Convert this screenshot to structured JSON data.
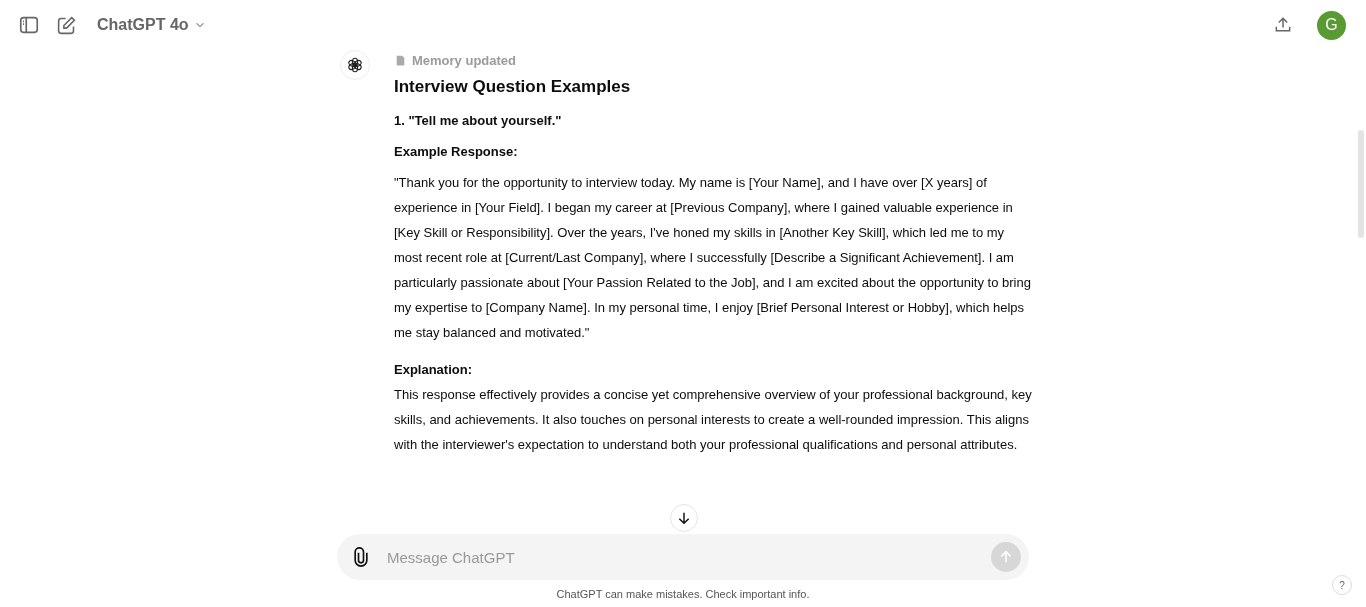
{
  "header": {
    "model": "ChatGPT 4o",
    "avatar": "G"
  },
  "message": {
    "status": "Memory updated",
    "title": "Interview Question Examples",
    "blocks": [
      {
        "kind": "bold",
        "text": "1. \"Tell me about yourself.\""
      },
      {
        "kind": "bold",
        "text": "Example Response:"
      },
      {
        "kind": "para",
        "text": "\"Thank you for the opportunity to interview today. My name is [Your Name], and I have over [X years] of experience in [Your Field]. I began my career at [Previous Company], where I gained valuable experience in [Key Skill or Responsibility]. Over the years, I've honed my skills in [Another Key Skill], which led me to my most recent role at [Current/Last Company], where I successfully [Describe a Significant Achievement]. I am particularly passionate about [Your Passion Related to the Job], and I am excited about the opportunity to bring my expertise to [Company Name]. In my personal time, I enjoy [Brief Personal Interest or Hobby], which helps me stay balanced and motivated.\""
      },
      {
        "kind": "heading",
        "text": "Explanation:"
      },
      {
        "kind": "para",
        "text": "This response effectively provides a concise yet comprehensive overview of your professional background, key skills, and achievements. It also touches on personal interests to create a well-rounded impression. This aligns with the interviewer's expectation to understand both your professional qualifications and personal attributes."
      }
    ]
  },
  "composer": {
    "placeholder": "Message ChatGPT"
  },
  "footer": "ChatGPT can make mistakes. Check important info.",
  "help": "?"
}
